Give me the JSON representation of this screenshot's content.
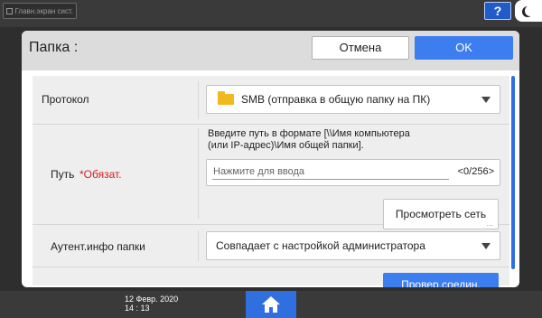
{
  "system": {
    "home_screen_label": "Главн.экран сист.",
    "help_label": "?",
    "help_icon": "question-mark-icon",
    "night_icon": "crescent-moon-icon"
  },
  "dialog": {
    "title": "Папка :",
    "cancel_label": "Отмена",
    "ok_label": "OK"
  },
  "protocol": {
    "label": "Протокол",
    "value": "SMB (отправка в общую папку на ПК)",
    "icon": "folder-icon"
  },
  "path": {
    "label": "Путь",
    "required_label": "*Обязат.",
    "hint_line1": "Введите путь в формате [\\\\Имя компьютера",
    "hint_line2": "(или IP-адрес)\\Имя общей папки].",
    "placeholder": "Нажмите для ввода",
    "counter": "<0/256>",
    "browse_label": "Просмотреть сеть",
    "browse_dots": "..."
  },
  "auth": {
    "label": "Аутент.инфо папки",
    "value": "Совпадает с настройкой администратора"
  },
  "check": {
    "label": "Провер.соедин."
  },
  "status": {
    "date": "12 Февр. 2020",
    "time": "14 : 13",
    "home_icon": "home-icon"
  },
  "colors": {
    "accent": "#3c7df0",
    "required": "#d42020",
    "folder": "#f2b820"
  }
}
